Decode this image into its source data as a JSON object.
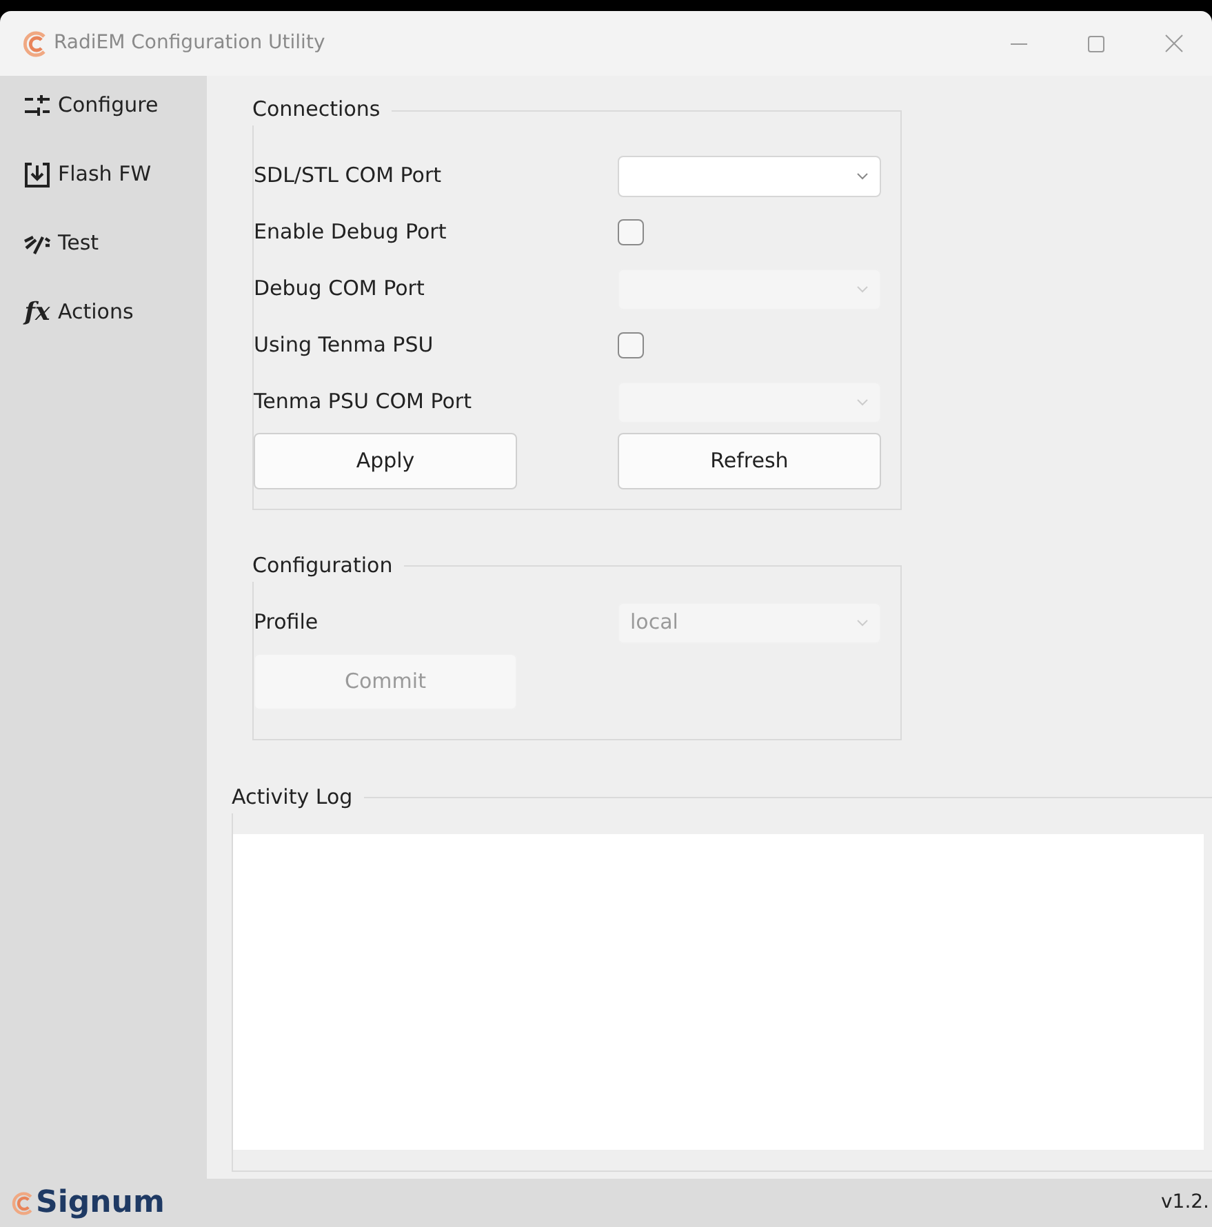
{
  "window": {
    "title": "RadiEM Configuration Utility"
  },
  "sidebar": {
    "items": [
      {
        "label": "Configure"
      },
      {
        "label": "Flash FW"
      },
      {
        "label": "Test"
      },
      {
        "label": "Actions",
        "symbol": "fx"
      }
    ]
  },
  "connections": {
    "title": "Connections",
    "rows": [
      {
        "kind": "select",
        "label": "SDL/STL COM Port",
        "disabled": false
      },
      {
        "kind": "checkbox",
        "label": "Enable Debug Port",
        "checked": false
      },
      {
        "kind": "select",
        "label": "Debug COM Port",
        "disabled": true
      },
      {
        "kind": "checkbox",
        "label": "Using Tenma PSU",
        "checked": false
      },
      {
        "kind": "select",
        "label": "Tenma PSU COM Port",
        "disabled": true
      }
    ],
    "buttons": [
      {
        "label": "Apply",
        "disabled": false
      },
      {
        "label": "Refresh",
        "disabled": false
      }
    ]
  },
  "configuration": {
    "title": "Configuration",
    "profile": {
      "label": "Profile",
      "value": "local",
      "disabled": true
    },
    "button": {
      "label": "Commit",
      "disabled": true
    }
  },
  "activity_log": {
    "title": "Activity Log"
  },
  "status_bar": {
    "brand": "Signum",
    "version": "v1.2."
  }
}
